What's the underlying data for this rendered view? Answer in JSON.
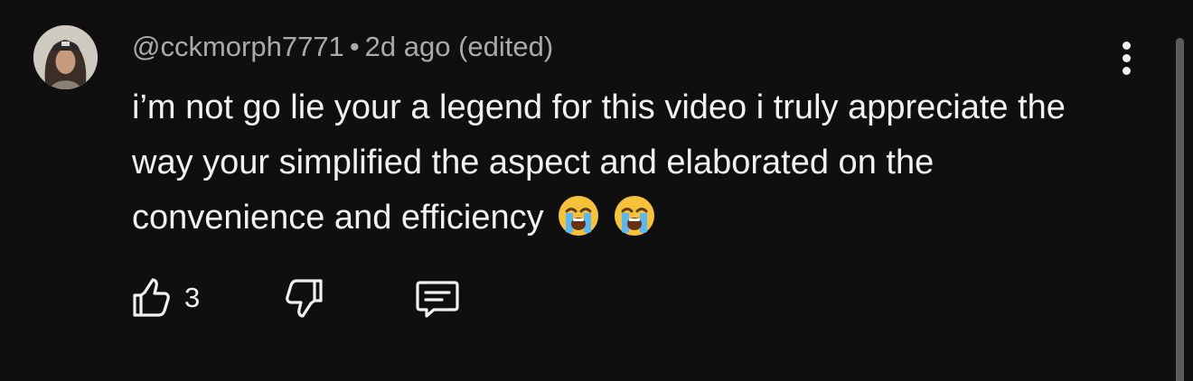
{
  "comment": {
    "username": "@cckmorph7771",
    "separator": "•",
    "timestamp": "2d ago (edited)",
    "text": "i’m not go lie your a legend for this video i truly appreciate the way your simplified the aspect and elaborated on the convenience and efficiency",
    "emojis": [
      "loudly-crying-face-emoji",
      "loudly-crying-face-emoji"
    ],
    "like_count": "3"
  },
  "icons": {
    "more": "more-vertical-icon",
    "like": "thumbs-up-icon",
    "dislike": "thumbs-down-icon",
    "reply": "reply-comment-icon"
  },
  "colors": {
    "background": "#0f0f0f",
    "primary_text": "#f1f1f1",
    "secondary_text": "#aaaaaa"
  }
}
